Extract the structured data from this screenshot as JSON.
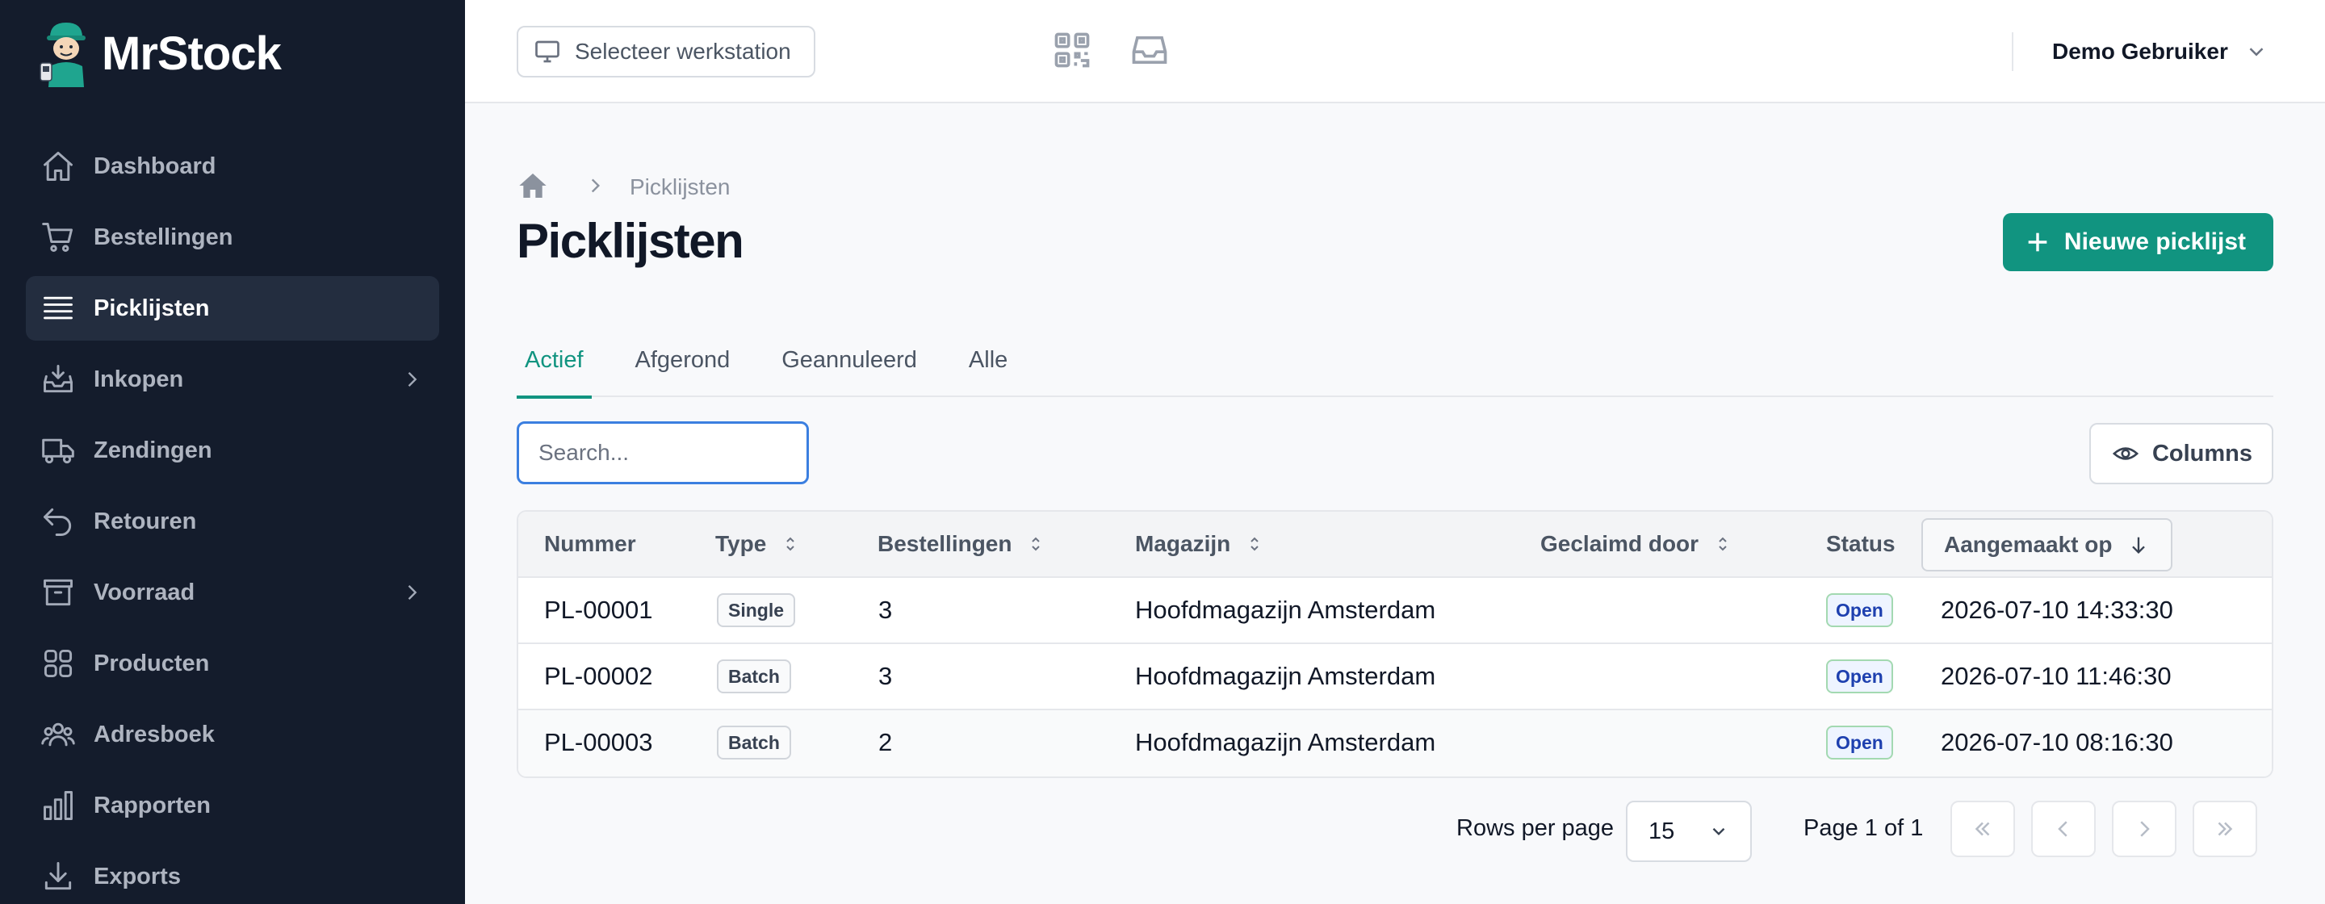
{
  "app": {
    "name": "MrStock"
  },
  "sidebar": {
    "items": [
      {
        "label": "Dashboard",
        "icon": "home-icon"
      },
      {
        "label": "Bestellingen",
        "icon": "cart-icon"
      },
      {
        "label": "Picklijsten",
        "icon": "list-icon",
        "active": true
      },
      {
        "label": "Inkopen",
        "icon": "inbox-download-icon",
        "has_children": true
      },
      {
        "label": "Zendingen",
        "icon": "truck-icon"
      },
      {
        "label": "Retouren",
        "icon": "return-arrow-icon"
      },
      {
        "label": "Voorraad",
        "icon": "archive-box-icon",
        "has_children": true
      },
      {
        "label": "Producten",
        "icon": "grid-icon"
      },
      {
        "label": "Adresboek",
        "icon": "users-icon"
      },
      {
        "label": "Rapporten",
        "icon": "bar-chart-icon"
      },
      {
        "label": "Exports",
        "icon": "download-icon"
      }
    ]
  },
  "topbar": {
    "workstation_label": "Selecteer werkstation",
    "user_name": "Demo Gebruiker"
  },
  "breadcrumb": {
    "current": "Picklijsten"
  },
  "page": {
    "title": "Picklijsten",
    "new_button_label": "Nieuwe picklijst"
  },
  "tabs": [
    {
      "label": "Actief",
      "active": true
    },
    {
      "label": "Afgerond"
    },
    {
      "label": "Geannuleerd"
    },
    {
      "label": "Alle"
    }
  ],
  "search": {
    "placeholder": "Search...",
    "value": ""
  },
  "columns_button_label": "Columns",
  "table": {
    "headers": {
      "nummer": "Nummer",
      "type": "Type",
      "bestellingen": "Bestellingen",
      "magazijn": "Magazijn",
      "geclaimd": "Geclaimd door",
      "status": "Status",
      "aangemaakt": "Aangemaakt op"
    },
    "rows": [
      {
        "nummer": "PL-00001",
        "type": "Single",
        "bestellingen": "3",
        "magazijn": "Hoofdmagazijn Amsterdam",
        "geclaimd": "",
        "status": "Open",
        "aangemaakt": "2026-07-10 14:33:30"
      },
      {
        "nummer": "PL-00002",
        "type": "Batch",
        "bestellingen": "3",
        "magazijn": "Hoofdmagazijn Amsterdam",
        "geclaimd": "",
        "status": "Open",
        "aangemaakt": "2026-07-10 11:46:30"
      },
      {
        "nummer": "PL-00003",
        "type": "Batch",
        "bestellingen": "2",
        "magazijn": "Hoofdmagazijn Amsterdam",
        "geclaimd": "",
        "status": "Open",
        "aangemaakt": "2026-07-10 08:16:30"
      }
    ]
  },
  "pagination": {
    "rows_per_page_label": "Rows per page",
    "rows_per_page": "15",
    "page_info": "Page 1 of 1"
  },
  "colors": {
    "sidebar_bg": "#141c2c",
    "accent": "#119480",
    "focus": "#3b7fe0"
  }
}
